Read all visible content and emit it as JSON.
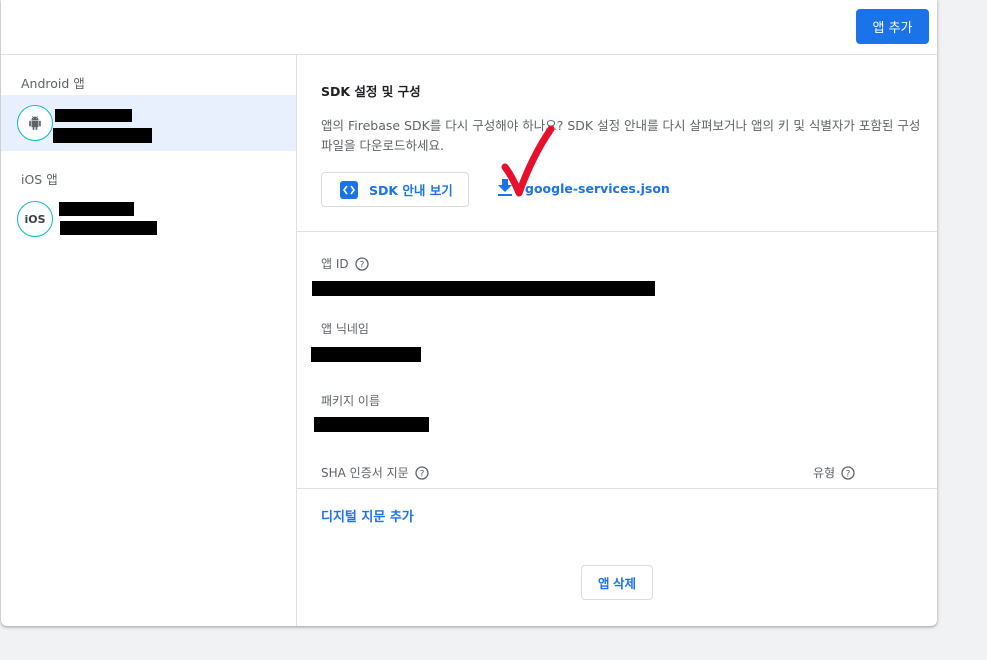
{
  "header": {
    "add_app_label": "앱 추가"
  },
  "sidebar": {
    "android_heading": "Android 앱",
    "ios_heading": "iOS 앱",
    "android_icon": "android-icon",
    "ios_icon_label": "iOS"
  },
  "sdk": {
    "title": "SDK 설정 및 구성",
    "description": "앱의 Firebase SDK를 다시 구성해야 하나요? SDK 설정 안내를 다시 살펴보거나 앱의 키 및 식별자가 포함된 구성 파일을 다운로드하세요.",
    "guide_button_label": "SDK 안내 보기",
    "download_label": "google-services.json"
  },
  "fields": {
    "app_id_label": "앱 ID",
    "nickname_label": "앱 닉네임",
    "package_label": "패키지 이름",
    "sha_label": "SHA 인증서 지문",
    "type_label": "유형",
    "add_fingerprint_label": "디지털 지문 추가"
  },
  "actions": {
    "delete_label": "앱 삭제"
  },
  "colors": {
    "accent": "#1a73e8",
    "selected_bg": "#e8f0fe",
    "avatar_ring": "#12b5cb",
    "annotation": "#e8112d"
  }
}
